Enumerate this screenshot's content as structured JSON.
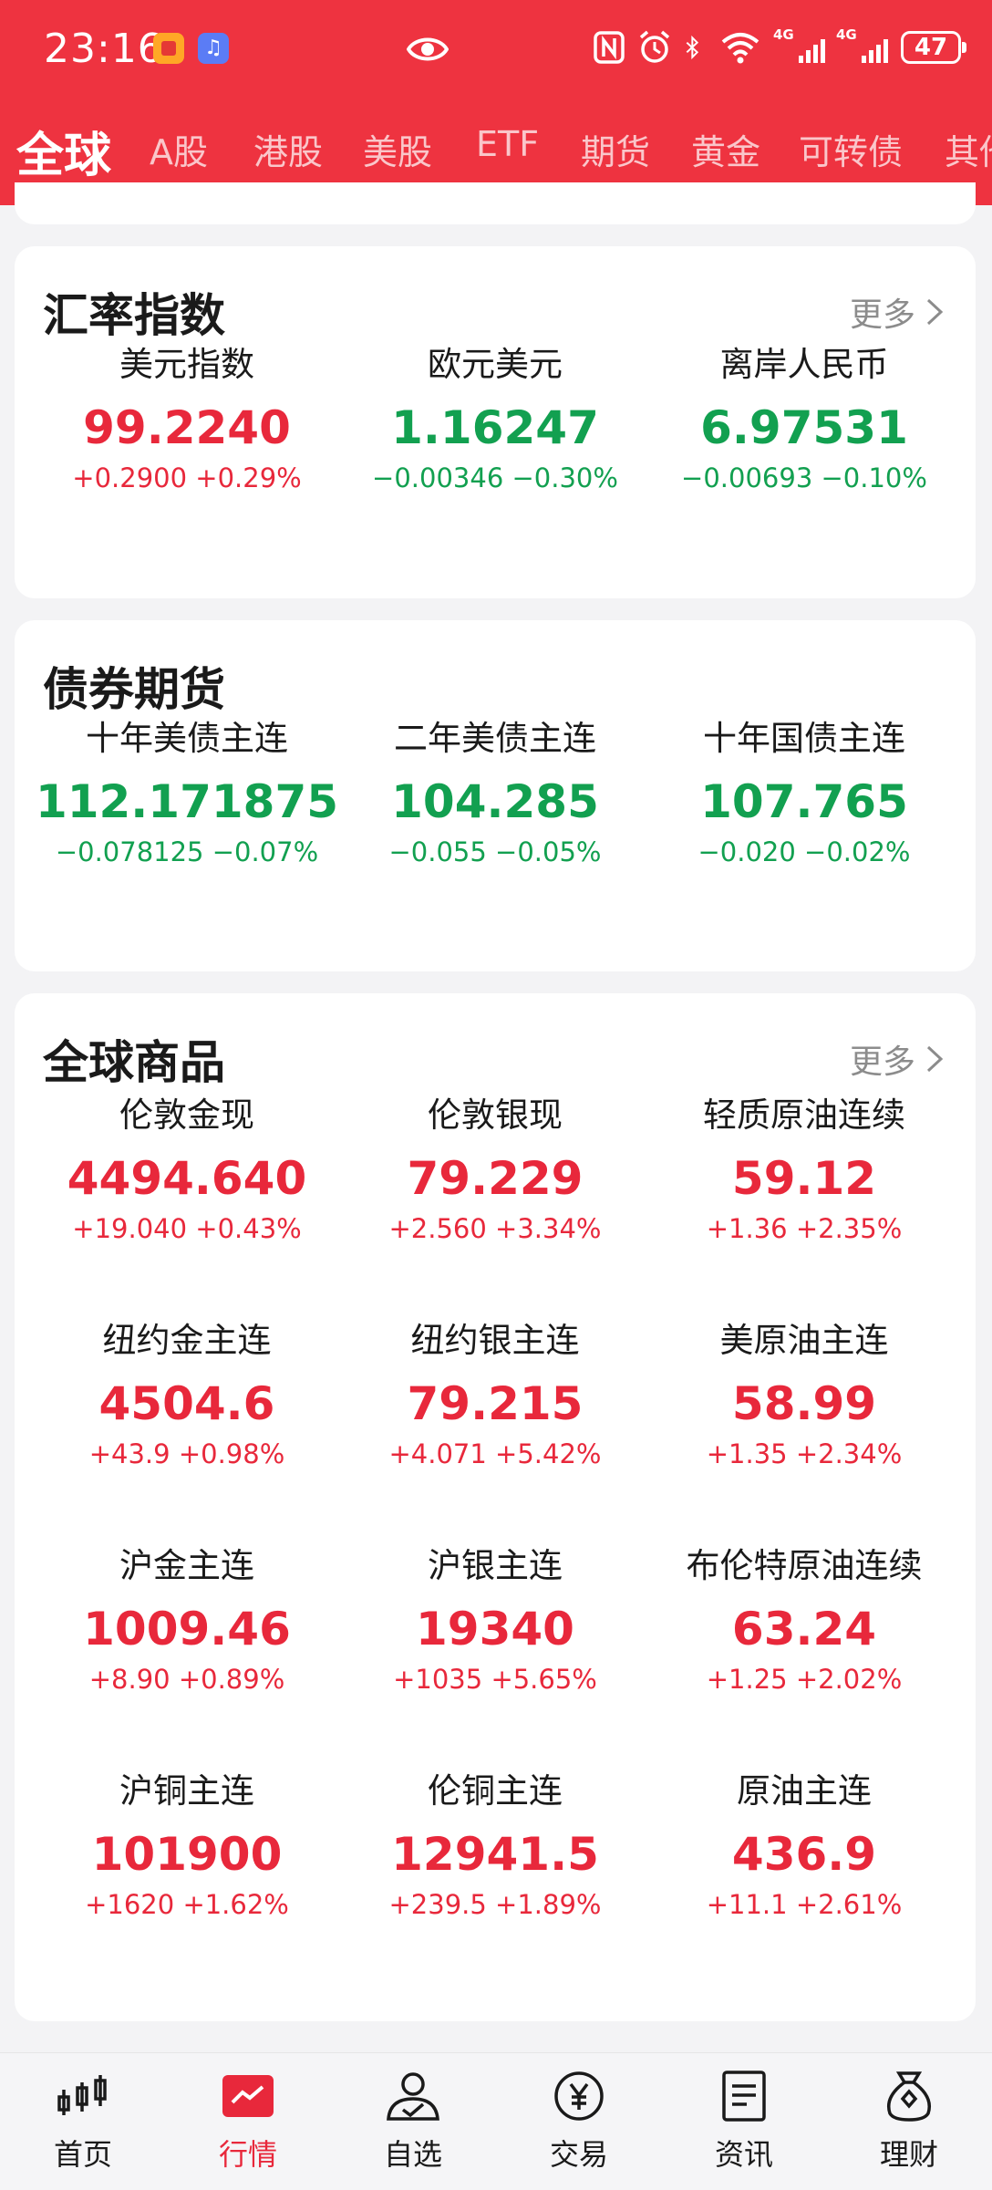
{
  "status_bar": {
    "time": "23:16",
    "battery": "47",
    "network": "4G",
    "icons": [
      "app-notification-icon",
      "music-app-icon",
      "eye-icon",
      "nfc-icon",
      "alarm-icon",
      "bluetooth-icon",
      "wifi-icon",
      "signal-4g-icon",
      "battery-icon"
    ]
  },
  "tabs": [
    {
      "label": "全球",
      "active": true
    },
    {
      "label": "A股"
    },
    {
      "label": "港股"
    },
    {
      "label": "美股"
    },
    {
      "label": "ETF"
    },
    {
      "label": "期货"
    },
    {
      "label": "黄金"
    },
    {
      "label": "可转债"
    },
    {
      "label": "其他"
    }
  ],
  "forex": {
    "title": "汇率指数",
    "more": "更多",
    "items": [
      {
        "name": "美元指数",
        "price": "99.2240",
        "change": "+0.2900",
        "percent": "+0.29%",
        "trend": "up"
      },
      {
        "name": "欧元美元",
        "price": "1.16247",
        "change": "−0.00346",
        "percent": "−0.30%",
        "trend": "down"
      },
      {
        "name": "离岸人民币",
        "price": "6.97531",
        "change": "−0.00693",
        "percent": "−0.10%",
        "trend": "down"
      }
    ]
  },
  "bonds": {
    "title": "债券期货",
    "items": [
      {
        "name": "十年美债主连",
        "price": "112.171875",
        "change": "−0.078125",
        "percent": "−0.07%",
        "trend": "down"
      },
      {
        "name": "二年美债主连",
        "price": "104.285",
        "change": "−0.055",
        "percent": "−0.05%",
        "trend": "down"
      },
      {
        "name": "十年国债主连",
        "price": "107.765",
        "change": "−0.020",
        "percent": "−0.02%",
        "trend": "down"
      }
    ]
  },
  "commodities": {
    "title": "全球商品",
    "more": "更多",
    "items": [
      {
        "name": "伦敦金现",
        "price": "4494.640",
        "change": "+19.040",
        "percent": "+0.43%",
        "trend": "up"
      },
      {
        "name": "伦敦银现",
        "price": "79.229",
        "change": "+2.560",
        "percent": "+3.34%",
        "trend": "up"
      },
      {
        "name": "轻质原油连续",
        "price": "59.12",
        "change": "+1.36",
        "percent": "+2.35%",
        "trend": "up"
      },
      {
        "name": "纽约金主连",
        "price": "4504.6",
        "change": "+43.9",
        "percent": "+0.98%",
        "trend": "up"
      },
      {
        "name": "纽约银主连",
        "price": "79.215",
        "change": "+4.071",
        "percent": "+5.42%",
        "trend": "up"
      },
      {
        "name": "美原油主连",
        "price": "58.99",
        "change": "+1.35",
        "percent": "+2.34%",
        "trend": "up"
      },
      {
        "name": "沪金主连",
        "price": "1009.46",
        "change": "+8.90",
        "percent": "+0.89%",
        "trend": "up"
      },
      {
        "name": "沪银主连",
        "price": "19340",
        "change": "+1035",
        "percent": "+5.65%",
        "trend": "up"
      },
      {
        "name": "布伦特原油连续",
        "price": "63.24",
        "change": "+1.25",
        "percent": "+2.02%",
        "trend": "up"
      },
      {
        "name": "沪铜主连",
        "price": "101900",
        "change": "+1620",
        "percent": "+1.62%",
        "trend": "up"
      },
      {
        "name": "伦铜主连",
        "price": "12941.5",
        "change": "+239.5",
        "percent": "+1.89%",
        "trend": "up"
      },
      {
        "name": "原油主连",
        "price": "436.9",
        "change": "+11.1",
        "percent": "+2.61%",
        "trend": "up"
      }
    ]
  },
  "bottom_nav": [
    {
      "label": "首页",
      "icon": "candlestick-icon"
    },
    {
      "label": "行情",
      "icon": "market-chart-icon",
      "active": true
    },
    {
      "label": "自选",
      "icon": "user-check-icon"
    },
    {
      "label": "交易",
      "icon": "yuan-coin-icon"
    },
    {
      "label": "资讯",
      "icon": "document-icon"
    },
    {
      "label": "理财",
      "icon": "money-bag-icon"
    }
  ],
  "colors": {
    "brand": "#ee3340",
    "up": "#e8283b",
    "down": "#12a050"
  }
}
